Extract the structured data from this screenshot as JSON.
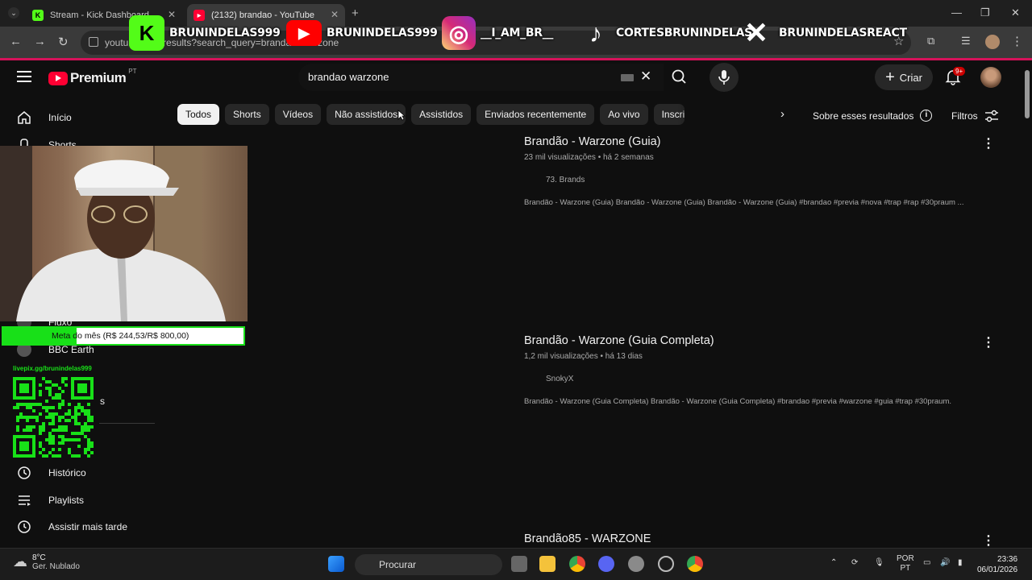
{
  "browser": {
    "tabs": [
      {
        "title": "Stream - Kick Dashboard"
      },
      {
        "title": "(2132) brandao - YouTube"
      }
    ],
    "url": "youtube.com/results?search_query=brandao+warzone"
  },
  "overlay": {
    "socials": [
      {
        "platform": "Kick",
        "handle": "BRUNINDELAS999",
        "icon": "kick-icon",
        "glyph": "K",
        "color": "#53fc18"
      },
      {
        "platform": "YouTube",
        "handle": "BRUNINDELAS999",
        "icon": "youtube-icon",
        "glyph": "▶",
        "color": "#ff0000"
      },
      {
        "platform": "Instagram",
        "handle": "__I_AM_BR__",
        "icon": "instagram-icon",
        "glyph": "◎",
        "color": "#e1306c"
      },
      {
        "platform": "TikTok",
        "handle": "CORTESBRUNINDELAS",
        "icon": "tiktok-icon",
        "glyph": "♪",
        "color": "#ffffff"
      },
      {
        "platform": "X",
        "handle": "BRUNINDELASREACT",
        "icon": "x-icon",
        "glyph": "✕",
        "color": "#ffffff"
      }
    ],
    "goal": {
      "label": "Meta do mês (R$ 244,53/R$ 800,00)",
      "progress": 0.3057
    },
    "qr_label": "livepix.gg/brunindelas999"
  },
  "youtube": {
    "logo": {
      "brand": "Premium",
      "region": "PT"
    },
    "search": {
      "query": "brandao warzone"
    },
    "create_label": "Criar",
    "notifications_badge": "9+",
    "chips": [
      "Todos",
      "Shorts",
      "Vídeos",
      "Não assistidos",
      "Assistidos",
      "Enviados recentemente",
      "Ao vivo",
      "Inscriç"
    ],
    "about_results": "Sobre esses resultados",
    "filters_label": "Filtros",
    "sidebar": {
      "top": [
        {
          "label": "Início",
          "icon": "home-icon"
        },
        {
          "label": "Shorts",
          "icon": "shorts-icon"
        }
      ],
      "subs": [
        {
          "label": "Fluxo"
        },
        {
          "label": "BBC Earth"
        },
        {
          "label": "s"
        }
      ],
      "you": [
        {
          "label": "Histórico",
          "icon": "history-icon"
        },
        {
          "label": "Playlists",
          "icon": "playlists-icon"
        },
        {
          "label": "Assistir mais tarde",
          "icon": "watch-later-icon"
        }
      ]
    },
    "results": [
      {
        "title": "Brandão - Warzone (Guia)",
        "meta": "23 mil visualizações • há 2 semanas",
        "channel": "73. Brands",
        "description": "Brandão - Warzone (Guia) Brandão - Warzone (Guia) Brandão - Warzone (Guia) #brandao #previa #nova #trap #rap #30praum ..."
      },
      {
        "title": "Brandão - Warzone (Guia Completa)",
        "meta": "1,2 mil visualizações • há 13 dias",
        "channel": "SnokyX",
        "description": "Brandão - Warzone (Guia Completa) Brandão - Warzone (Guia Completa) #brandao #previa #warzone #guia #trap #30praum."
      },
      {
        "title": "Brandão85 - WARZONE",
        "meta": "",
        "channel": "",
        "description": ""
      }
    ]
  },
  "taskbar": {
    "weather_temp": "8°C",
    "weather_desc": "Ger. Nublado",
    "search_label": "Procurar",
    "lang_top": "POR",
    "lang_bottom": "PT",
    "time": "23:36",
    "date": "06/01/2026"
  }
}
